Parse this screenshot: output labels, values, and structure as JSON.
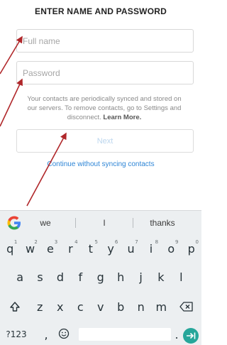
{
  "header": {
    "title": "ENTER NAME AND PASSWORD"
  },
  "form": {
    "name_placeholder": "Full name",
    "password_placeholder": "Password",
    "info_text": "Your contacts are periodically synced and stored on our servers. To remove contacts, go to Settings and disconnect.",
    "learn_more": "Learn More.",
    "next_label": "Next",
    "skip_link": "Continue without syncing contacts"
  },
  "keyboard": {
    "suggestions": [
      "we",
      "I",
      "thanks"
    ],
    "row1": [
      {
        "k": "q",
        "s": "1"
      },
      {
        "k": "w",
        "s": "2"
      },
      {
        "k": "e",
        "s": "3"
      },
      {
        "k": "r",
        "s": "4"
      },
      {
        "k": "t",
        "s": "5"
      },
      {
        "k": "y",
        "s": "6"
      },
      {
        "k": "u",
        "s": "7"
      },
      {
        "k": "i",
        "s": "8"
      },
      {
        "k": "o",
        "s": "9"
      },
      {
        "k": "p",
        "s": "0"
      }
    ],
    "row2": [
      "a",
      "s",
      "d",
      "f",
      "g",
      "h",
      "j",
      "k",
      "l"
    ],
    "row3": [
      "z",
      "x",
      "c",
      "v",
      "b",
      "n",
      "m"
    ],
    "symbols_label": "?123",
    "comma_label": ",",
    "period_label": "."
  },
  "colors": {
    "accent": "#2d85d6",
    "enter_key": "#26a69a",
    "arrow": "#b0272a"
  }
}
